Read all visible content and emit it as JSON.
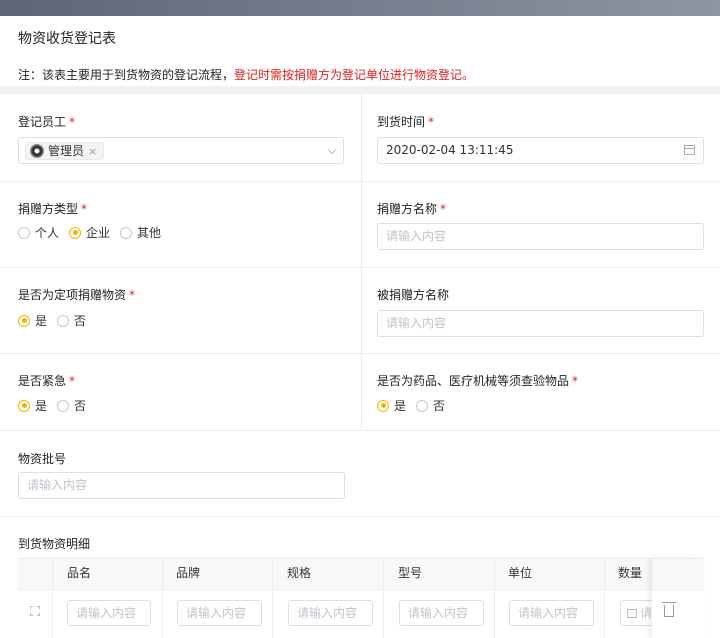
{
  "page": {
    "title": "物资收货登记表",
    "notice_prefix": "注：该表主要用于到货物资的登记流程，",
    "notice_highlight": "登记时需按捐赠方为登记单位进行物资登记。"
  },
  "form": {
    "registrar": {
      "label": "登记员工",
      "required": "*",
      "tag": "管理员",
      "tag_close": "×"
    },
    "arrival_time": {
      "label": "到货时间",
      "required": "*",
      "value": "2020-02-04 13:11:45"
    },
    "donor_type": {
      "label": "捐赠方类型",
      "required": "*",
      "options": [
        "个人",
        "企业",
        "其他"
      ],
      "selected": "企业"
    },
    "donor_name": {
      "label": "捐赠方名称",
      "required": "*",
      "placeholder": "请输入内容"
    },
    "designated": {
      "label": "是否为定项捐赠物资",
      "required": "*",
      "options": [
        "是",
        "否"
      ],
      "selected": "是"
    },
    "recipient_name": {
      "label": "被捐赠方名称",
      "placeholder": "请输入内容"
    },
    "urgent": {
      "label": "是否紧急",
      "required": "*",
      "options": [
        "是",
        "否"
      ],
      "selected": "是"
    },
    "medical": {
      "label": "是否为药品、医疗机械等须查验物品",
      "required": "*",
      "options": [
        "是",
        "否"
      ],
      "selected": "是"
    },
    "batch_no": {
      "label": "物资批号",
      "placeholder": "请输入内容"
    }
  },
  "details": {
    "label": "到货物资明细",
    "columns": [
      "品名",
      "品牌",
      "规格",
      "型号",
      "单位",
      "数量"
    ],
    "row_placeholders": [
      "请输入内容",
      "请输入内容",
      "请输入内容",
      "请输入内容",
      "请输入内容",
      "请"
    ]
  },
  "colors": {
    "accent": "#f0b400",
    "required": "#e02020"
  },
  "icons": [
    "calendar-icon",
    "chevron-down-icon",
    "avatar-icon",
    "drag-handle-icon",
    "trash-icon",
    "number-input-icon"
  ]
}
